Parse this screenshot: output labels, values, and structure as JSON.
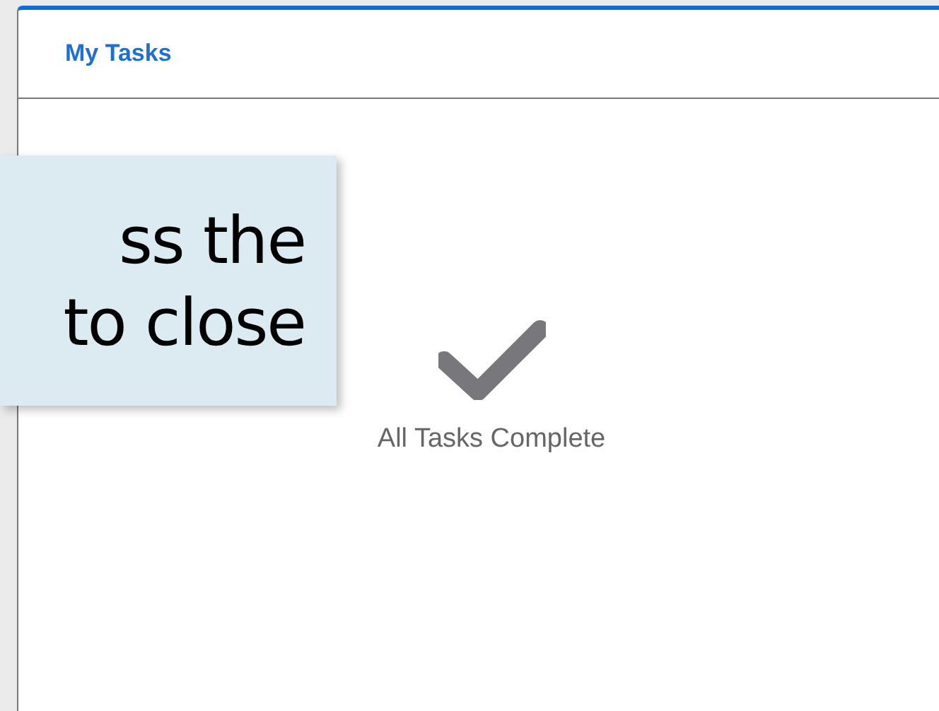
{
  "panel": {
    "title": "My Tasks",
    "empty_state": {
      "message": "All Tasks Complete"
    }
  },
  "callout": {
    "lines": [
      "ss the",
      "to close"
    ]
  }
}
